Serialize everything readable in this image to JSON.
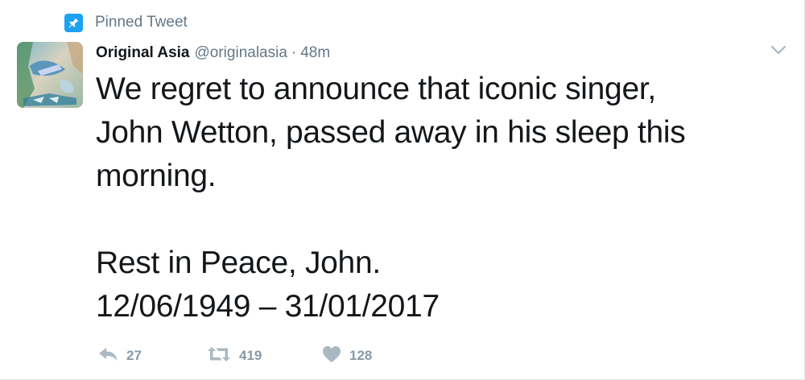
{
  "pinned": {
    "label": "Pinned Tweet",
    "icon": "pin-icon"
  },
  "author": {
    "name": "Original Asia",
    "handle": "@originalasia",
    "separator": "·",
    "time": "48m",
    "avatar_icon": "avatar-image"
  },
  "tweet": {
    "lines": [
      "We regret to announce that iconic singer,",
      "John Wetton, passed away in his sleep this",
      "morning.",
      "",
      "Rest in Peace, John.",
      "12/06/1949 – 31/01/2017"
    ]
  },
  "actions": {
    "reply": {
      "icon": "reply-icon",
      "count": "27"
    },
    "retweet": {
      "icon": "retweet-icon",
      "count": "419"
    },
    "like": {
      "icon": "heart-icon",
      "count": "128"
    },
    "more": {
      "icon": "chevron-down-icon"
    }
  },
  "colors": {
    "accent": "#1da1f2",
    "text": "#14171a",
    "secondary": "#657786",
    "action": "#8899a6"
  }
}
